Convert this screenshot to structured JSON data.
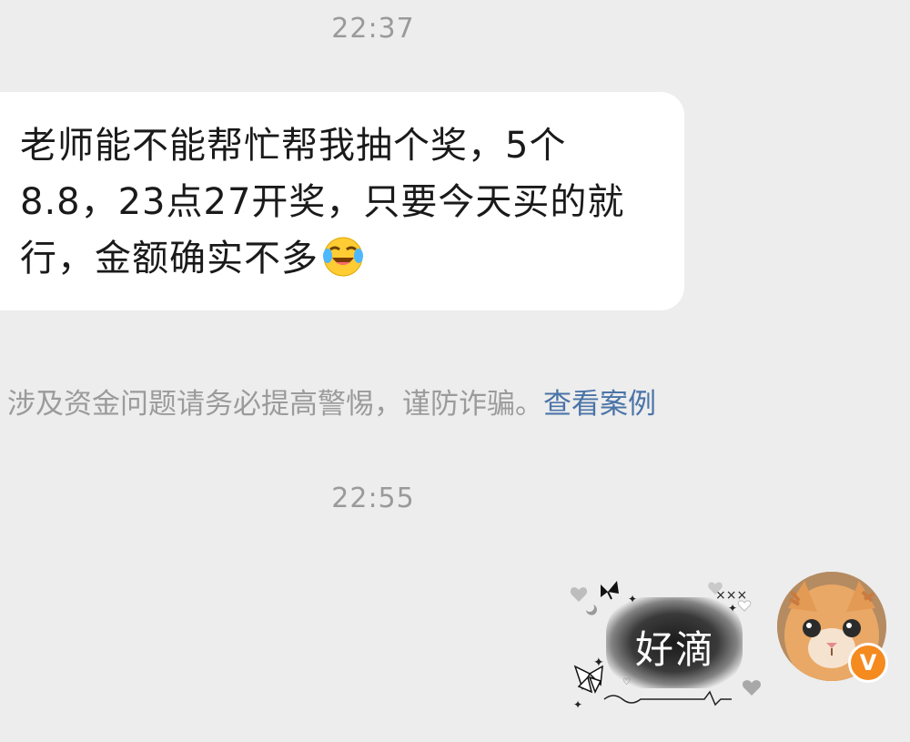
{
  "chat": {
    "timestamps": [
      "22:37",
      "22:55"
    ],
    "incoming_message": {
      "text": "老师能不能帮忙帮我抽个奖，5个8.8，23点27开奖，只要今天买的就行，金额确实不多",
      "emoji": "laughing-crying-emoji"
    },
    "system_notice": {
      "text": "涉及资金问题请务必提高警惕，谨防诈骗。",
      "link_label": "查看案例",
      "link_color": "#4a74a8"
    },
    "outgoing_sticker": {
      "text": "好滴",
      "decoration": "butterfly-heart-sticker"
    },
    "sender_avatar": {
      "description_icon": "cat-avatar",
      "badge": "V",
      "badge_color": "#f58a1f"
    }
  }
}
